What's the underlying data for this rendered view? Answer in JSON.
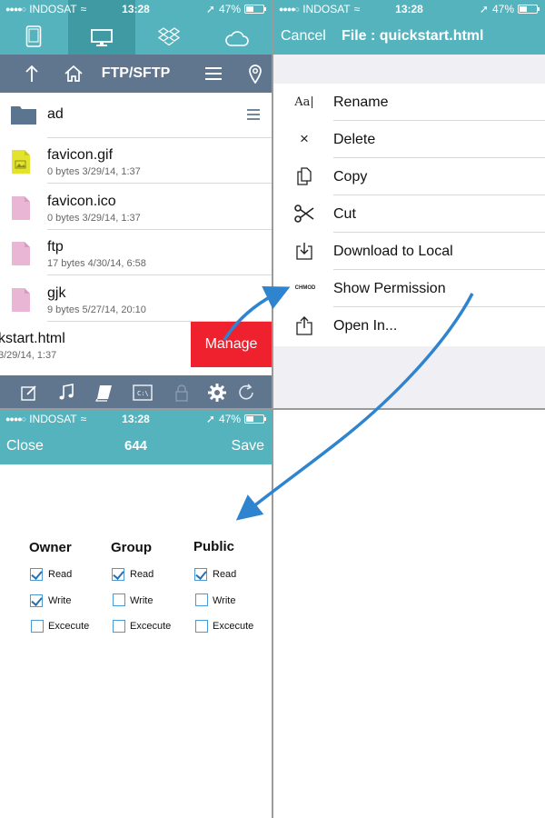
{
  "status": {
    "carrier": "INDOSAT",
    "time": "13:28",
    "battery": "47%"
  },
  "browser": {
    "tabs": [
      {
        "icon": "mobile-device-icon",
        "active": false
      },
      {
        "icon": "monitor-icon",
        "active": true
      },
      {
        "icon": "dropbox-icon",
        "active": false
      },
      {
        "icon": "cloud-icon",
        "active": false
      }
    ],
    "nav_title": "FTP/SFTP",
    "files": [
      {
        "name": "ad",
        "meta": "",
        "type": "folder"
      },
      {
        "name": "favicon.gif",
        "meta": "0 bytes 3/29/14, 1:37",
        "type": "image"
      },
      {
        "name": "favicon.ico",
        "meta": "0 bytes 3/29/14, 1:37",
        "type": "file"
      },
      {
        "name": "ftp",
        "meta": "17 bytes 4/30/14, 6:58",
        "type": "file"
      },
      {
        "name": "gjk",
        "meta": "9 bytes 5/27/14, 20:10",
        "type": "file"
      },
      {
        "name": "kstart.html",
        "meta": "3/29/14, 1:37",
        "type": "file"
      }
    ],
    "manage_label": "Manage"
  },
  "file_menu": {
    "cancel_label": "Cancel",
    "title": "File : quickstart.html",
    "items": [
      {
        "label": "Rename",
        "icon": "rename-icon",
        "icon_text": "Aa|"
      },
      {
        "label": "Delete",
        "icon": "close-icon",
        "icon_text": "×"
      },
      {
        "label": "Copy",
        "icon": "copy-icon",
        "icon_text": ""
      },
      {
        "label": "Cut",
        "icon": "scissors-icon",
        "icon_text": ""
      },
      {
        "label": "Download to Local",
        "icon": "download-icon",
        "icon_text": ""
      },
      {
        "label": "Show Permission",
        "icon": "chmod-icon",
        "icon_text": "CHMOD"
      },
      {
        "label": "Open In...",
        "icon": "share-icon",
        "icon_text": ""
      }
    ]
  },
  "permissions": {
    "close_label": "Close",
    "code": "644",
    "save_label": "Save",
    "columns": [
      {
        "title": "Owner",
        "options": [
          {
            "label": "Read",
            "checked": true
          },
          {
            "label": "Write",
            "checked": true
          },
          {
            "label": "Excecute",
            "checked": false
          }
        ]
      },
      {
        "title": "Group",
        "options": [
          {
            "label": "Read",
            "checked": true
          },
          {
            "label": "Write",
            "checked": false
          },
          {
            "label": "Excecute",
            "checked": false
          }
        ]
      },
      {
        "title": "Public",
        "options": [
          {
            "label": "Read",
            "checked": true
          },
          {
            "label": "Write",
            "checked": false
          },
          {
            "label": "Excecute",
            "checked": false
          }
        ]
      }
    ]
  },
  "colors": {
    "header": "#55b3bd",
    "navbar": "#60758e",
    "manage": "#f0212e",
    "arrow": "#2f84d0"
  }
}
